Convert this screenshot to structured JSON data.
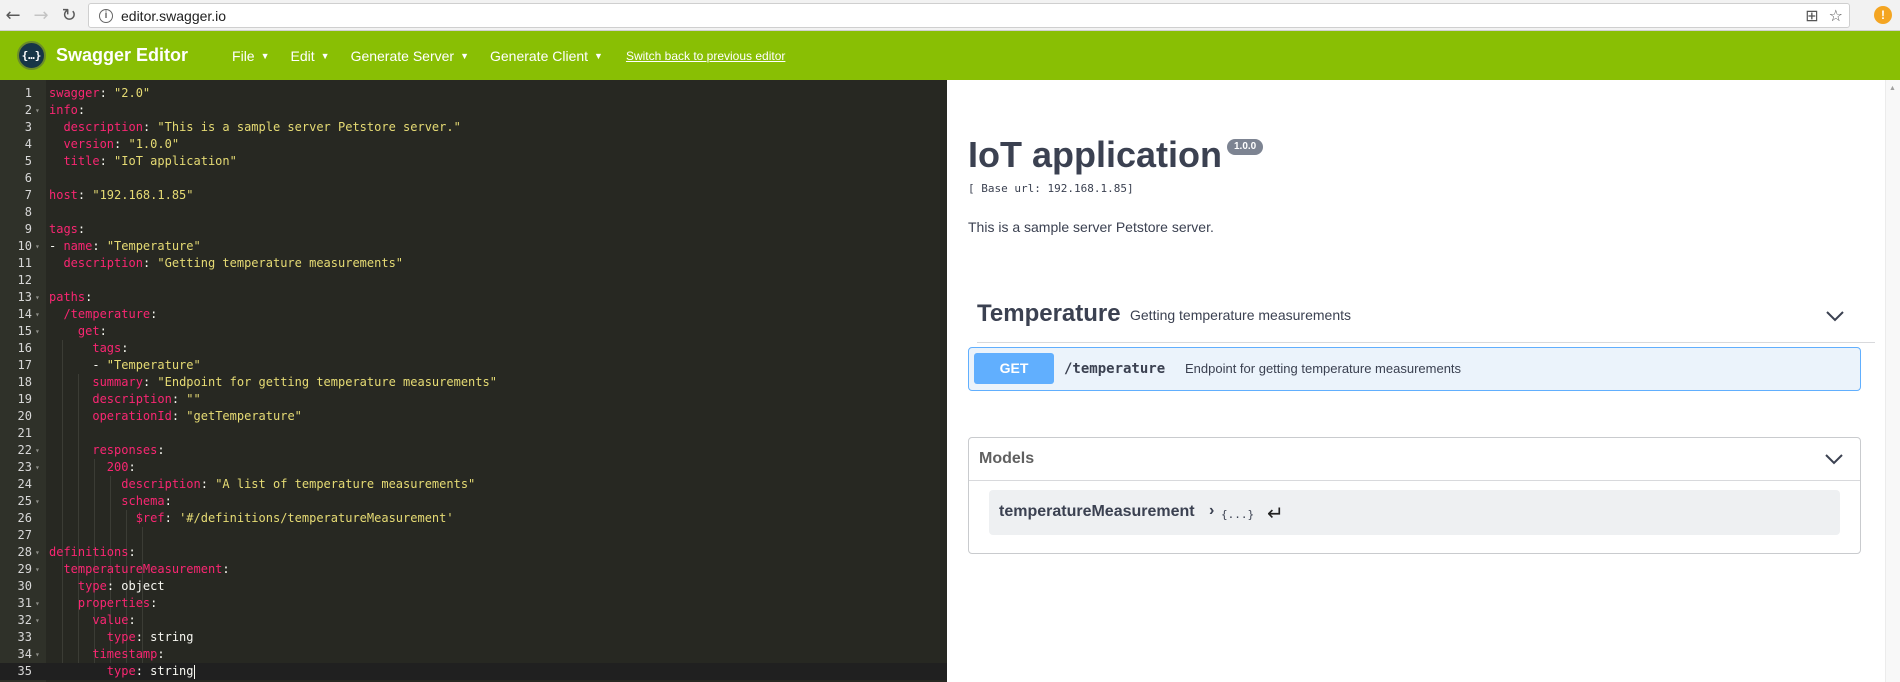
{
  "browser": {
    "url": "editor.swagger.io",
    "back_icon": "←",
    "forward_icon": "→",
    "reload_icon": "↻",
    "info_icon": "i",
    "translate_icon": "⊞",
    "star_icon": "☆",
    "ext_icon": "!"
  },
  "topbar": {
    "logo_glyph": "{…}",
    "app_name": "Swagger Editor",
    "menu": [
      {
        "label": "File"
      },
      {
        "label": "Edit"
      },
      {
        "label": "Generate Server"
      },
      {
        "label": "Generate Client"
      }
    ],
    "caret": "▼",
    "switch_link": "Switch back to previous editor"
  },
  "editor": {
    "lines": [
      {
        "n": "1",
        "fold": false,
        "html": "<span class=\"k\">swagger</span>: <span class=\"s\">\"2.0\"</span>"
      },
      {
        "n": "2",
        "fold": true,
        "html": "<span class=\"k\">info</span>:"
      },
      {
        "n": "3",
        "fold": false,
        "html": "  <span class=\"k\">description</span>: <span class=\"s\">\"This is a sample server Petstore server.\"</span>"
      },
      {
        "n": "4",
        "fold": false,
        "html": "  <span class=\"k\">version</span>: <span class=\"s\">\"1.0.0\"</span>"
      },
      {
        "n": "5",
        "fold": false,
        "html": "  <span class=\"k\">title</span>: <span class=\"s\">\"IoT application\"</span>"
      },
      {
        "n": "6",
        "fold": false,
        "html": ""
      },
      {
        "n": "7",
        "fold": false,
        "html": "<span class=\"k\">host</span>: <span class=\"s\">\"192.168.1.85\"</span>"
      },
      {
        "n": "8",
        "fold": false,
        "html": ""
      },
      {
        "n": "9",
        "fold": false,
        "html": "<span class=\"k\">tags</span>:"
      },
      {
        "n": "10",
        "fold": true,
        "html": "- <span class=\"k\">name</span>: <span class=\"s\">\"Temperature\"</span>"
      },
      {
        "n": "11",
        "fold": false,
        "html": "  <span class=\"k\">description</span>: <span class=\"s\">\"Getting temperature measurements\"</span>"
      },
      {
        "n": "12",
        "fold": false,
        "html": ""
      },
      {
        "n": "13",
        "fold": true,
        "html": "<span class=\"k\">paths</span>:"
      },
      {
        "n": "14",
        "fold": true,
        "html": "  <span class=\"k\">/temperature</span>:"
      },
      {
        "n": "15",
        "fold": true,
        "html": "    <span class=\"k\">get</span>:"
      },
      {
        "n": "16",
        "fold": false,
        "html": "      <span class=\"k\">tags</span>:"
      },
      {
        "n": "17",
        "fold": false,
        "html": "      - <span class=\"s\">\"Temperature\"</span>"
      },
      {
        "n": "18",
        "fold": false,
        "html": "      <span class=\"k\">summary</span>: <span class=\"s\">\"Endpoint for getting temperature measurements\"</span>"
      },
      {
        "n": "19",
        "fold": false,
        "html": "      <span class=\"k\">description</span>: <span class=\"s\">\"\"</span>"
      },
      {
        "n": "20",
        "fold": false,
        "html": "      <span class=\"k\">operationId</span>: <span class=\"s\">\"getTemperature\"</span>"
      },
      {
        "n": "21",
        "fold": false,
        "html": ""
      },
      {
        "n": "22",
        "fold": true,
        "html": "      <span class=\"k\">responses</span>:"
      },
      {
        "n": "23",
        "fold": true,
        "html": "        <span class=\"k\">200</span>:"
      },
      {
        "n": "24",
        "fold": false,
        "html": "          <span class=\"k\">description</span>: <span class=\"s\">\"A list of temperature measurements\"</span>"
      },
      {
        "n": "25",
        "fold": true,
        "html": "          <span class=\"k\">schema</span>:"
      },
      {
        "n": "26",
        "fold": false,
        "html": "            <span class=\"k\">$ref</span>: <span class=\"s\">'#/definitions/temperatureMeasurement'</span>"
      },
      {
        "n": "27",
        "fold": false,
        "html": ""
      },
      {
        "n": "28",
        "fold": true,
        "html": "<span class=\"k\">definitions</span>:"
      },
      {
        "n": "29",
        "fold": true,
        "html": "  <span class=\"k\">temperatureMeasurement</span>:"
      },
      {
        "n": "30",
        "fold": false,
        "html": "    <span class=\"k\">type</span>: object"
      },
      {
        "n": "31",
        "fold": true,
        "html": "    <span class=\"k\">properties</span>:"
      },
      {
        "n": "32",
        "fold": true,
        "html": "      <span class=\"k\">value</span>:"
      },
      {
        "n": "33",
        "fold": false,
        "html": "        <span class=\"k\">type</span>: string"
      },
      {
        "n": "34",
        "fold": true,
        "html": "      <span class=\"k\">timestamp</span>:"
      },
      {
        "n": "35",
        "fold": false,
        "html": "        <span class=\"k\">type</span>: string<span class=\"cursor\"></span>",
        "active": true
      }
    ],
    "fold_glyph": "▾"
  },
  "preview": {
    "title": "IoT application",
    "version": "1.0.0",
    "base_url": "[ Base url: 192.168.1.85]",
    "description": "This is a sample server Petstore server.",
    "tag": {
      "name": "Temperature",
      "description": "Getting temperature measurements"
    },
    "operation": {
      "method": "GET",
      "path": "/temperature",
      "summary": "Endpoint for getting temperature measurements"
    },
    "models": {
      "title": "Models",
      "model_name": "temperatureMeasurement",
      "arrow": "›",
      "brace": "{...}",
      "return_glyph": "↵"
    }
  },
  "colors": {
    "topbar": "#89bf04",
    "editor_bg": "#272822",
    "get_method": "#61affe",
    "key": "#f92672",
    "string": "#e6db74"
  }
}
